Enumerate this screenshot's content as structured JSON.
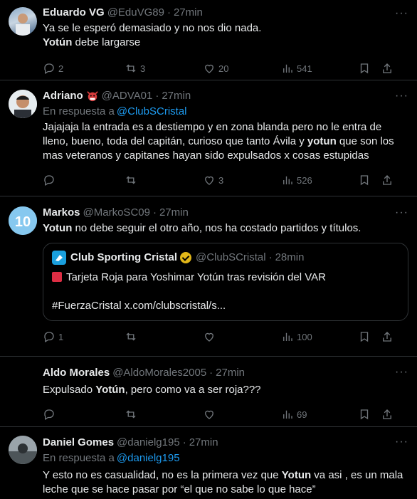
{
  "tweets": [
    {
      "name": "Eduardo VG",
      "handle": "@EduVG89",
      "time": "27min",
      "lines": [
        "Ya se le esperó demasiado y no nos dio nada."
      ],
      "line2_bold": "Yotún",
      "line2_rest": " debe largarse",
      "replies": "2",
      "reposts": "3",
      "likes": "20",
      "views": "541"
    },
    {
      "name": "Adriano",
      "handle": "@ADVA01",
      "time": "27min",
      "reply_prefix": "En respuesta a",
      "reply_to": "@ClubSCristal",
      "text_a": "Jajajaja la entrada es a destiempo y en zona blanda pero no le entra de lleno, bueno, toda del capitán, curioso que tanto Ávila y ",
      "text_bold": "yotun",
      "text_b": " que son los mas veteranos y capitanes hayan sido expulsados x cosas estupidas",
      "likes": "3",
      "views": "526"
    },
    {
      "name": "Markos",
      "handle": "@MarkoSC09",
      "time": "27min",
      "text_bold": "Yotun",
      "text_b": " no debe seguir el otro año, nos ha costado partidos y títulos.",
      "quote": {
        "name": "Club Sporting Cristal",
        "handle": "@ClubSCristal",
        "time": "28min",
        "line1": "Tarjeta Roja para Yoshimar Yotún tras revisión del VAR",
        "line2": "#FuerzaCristal x.com/clubscristal/s..."
      },
      "replies": "1",
      "views": "100",
      "avatar_number": "10"
    },
    {
      "name": "Aldo Morales",
      "handle": "@AldoMorales2005",
      "time": "27min",
      "text_a": "Expulsado ",
      "text_bold": "Yotún",
      "text_b": ", pero como va a ser roja???",
      "views": "69"
    },
    {
      "name": "Daniel Gomes",
      "handle": "@danielg195",
      "time": "27min",
      "reply_prefix": "En respuesta a",
      "reply_to": "@danielg195",
      "text_a": "Y esto no es casualidad, no es la primera vez que ",
      "text_bold": "Yotun",
      "text_b": " va asi , es un mala leche que se hace pasar por “el que no sabe lo que hace”"
    }
  ],
  "more_glyph": "···",
  "dot": "·",
  "colors": {
    "link": "#1d9bf0",
    "muted": "#71767b",
    "bg": "#000000",
    "border": "#2f3336"
  }
}
